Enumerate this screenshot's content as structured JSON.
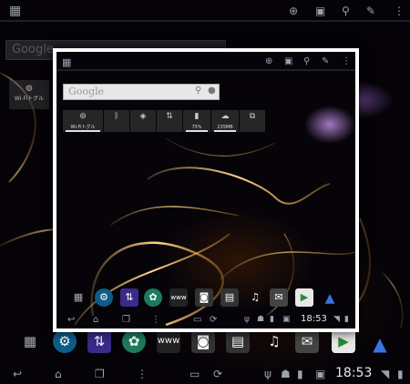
{
  "background_screen": {
    "action_bar_icons": [
      "apps-grid-icon",
      "add-icon",
      "image-icon",
      "search-icon",
      "pen-icon",
      "overflow-menu-icon"
    ],
    "search_widget": {
      "placeholder": "Google"
    },
    "wifi_tile_label": "Wi-Fiトグル",
    "dock_icons": [
      "apps-grid-icon",
      "settings-icon",
      "network-icon",
      "colors-icon",
      "www-icon",
      "camera-icon",
      "film-icon",
      "music-icon",
      "chat-icon",
      "play-store-icon",
      "navigation-arrow-icon"
    ],
    "nav_bar_icons": [
      "back-icon",
      "home-icon",
      "recent-apps-icon",
      "menu-icon",
      "screenshot-icon",
      "sync-icon",
      "usb-icon",
      "android-icon",
      "usb-storage-icon",
      "image-notify-icon"
    ],
    "clock": "18:53"
  },
  "preview_card": {
    "search_widget": {
      "placeholder": "Google"
    },
    "toggle_tiles": [
      {
        "name": "wifi",
        "label": "Wi-Fiトグル"
      },
      {
        "name": "bluetooth",
        "label": ""
      },
      {
        "name": "gps",
        "label": ""
      },
      {
        "name": "data",
        "label": ""
      },
      {
        "name": "battery",
        "label": "75%"
      },
      {
        "name": "memory",
        "label": "235MB"
      },
      {
        "name": "screen",
        "label": ""
      }
    ],
    "clock": "18:53"
  }
}
